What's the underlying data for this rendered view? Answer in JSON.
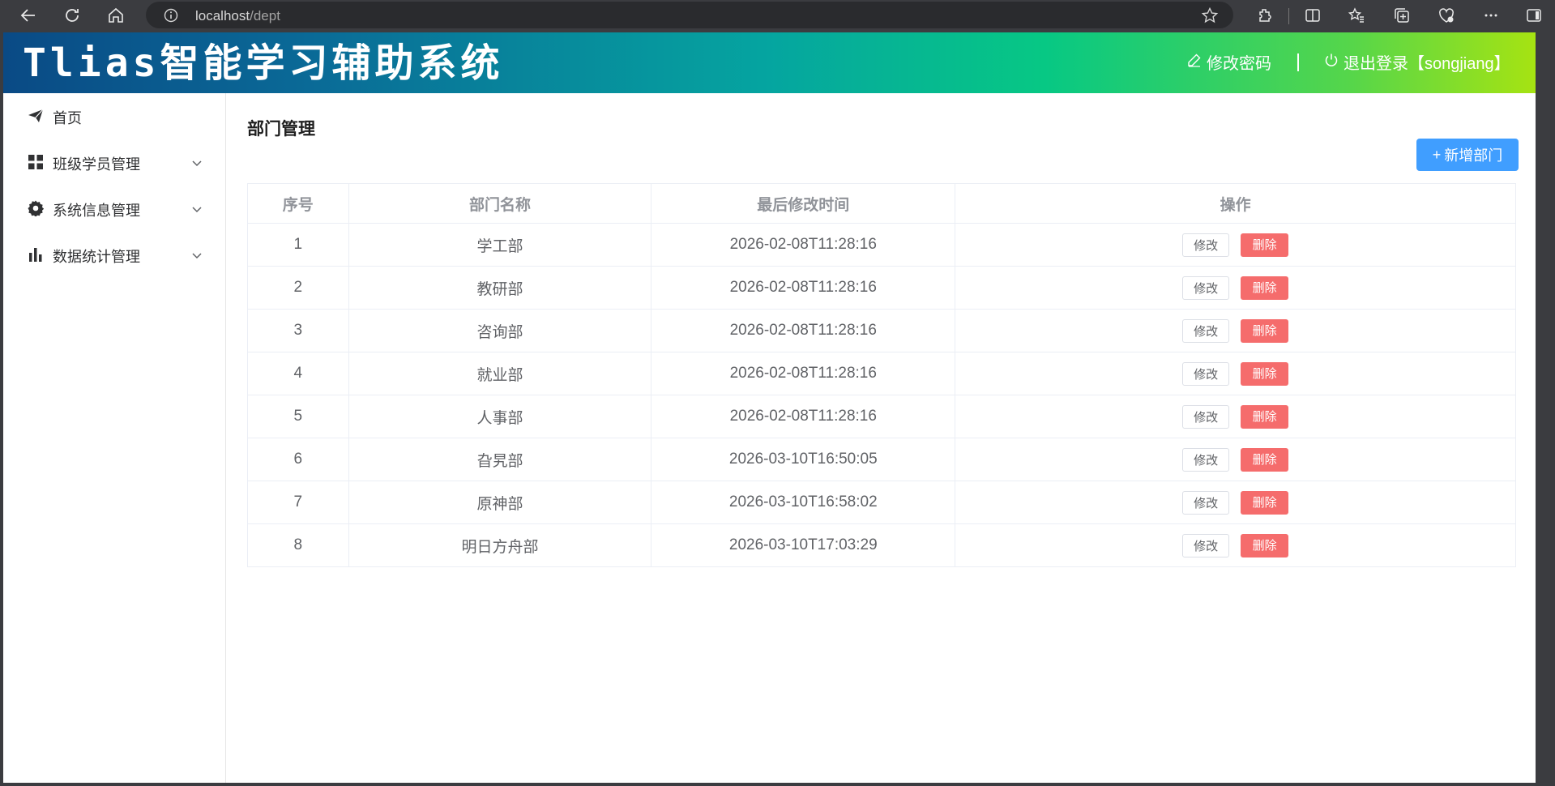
{
  "browser": {
    "url_host": "localhost",
    "url_path": "/dept"
  },
  "header": {
    "brand": "Tlias智能学习辅助系统",
    "change_password": "修改密码",
    "logout": "退出登录【songjiang】",
    "separator": "|"
  },
  "sidebar": {
    "items": [
      {
        "label": "首页",
        "icon": "paper-plane-icon"
      },
      {
        "label": "班级学员管理",
        "icon": "grid-icon"
      },
      {
        "label": "系统信息管理",
        "icon": "gear-icon"
      },
      {
        "label": "数据统计管理",
        "icon": "bar-chart-icon"
      }
    ]
  },
  "main": {
    "title": "部门管理",
    "add_button": "新增部门",
    "add_button_prefix": "+",
    "table": {
      "headers": [
        "序号",
        "部门名称",
        "最后修改时间",
        "操作"
      ],
      "edit_label": "修改",
      "delete_label": "删除",
      "rows": [
        {
          "index": "1",
          "name": "学工部",
          "time": "2026-02-08T11:28:16"
        },
        {
          "index": "2",
          "name": "教研部",
          "time": "2026-02-08T11:28:16"
        },
        {
          "index": "3",
          "name": "咨询部",
          "time": "2026-02-08T11:28:16"
        },
        {
          "index": "4",
          "name": "就业部",
          "time": "2026-02-08T11:28:16"
        },
        {
          "index": "5",
          "name": "人事部",
          "time": "2026-02-08T11:28:16"
        },
        {
          "index": "6",
          "name": "旮旯部",
          "time": "2026-03-10T16:50:05"
        },
        {
          "index": "7",
          "name": "原神部",
          "time": "2026-03-10T16:58:02"
        },
        {
          "index": "8",
          "name": "明日方舟部",
          "time": "2026-03-10T17:03:29"
        }
      ]
    }
  },
  "colors": {
    "primary": "#409eff",
    "danger": "#f56c6c",
    "header_gradient_start": "#0a4a85",
    "header_gradient_end": "#a6e312"
  }
}
